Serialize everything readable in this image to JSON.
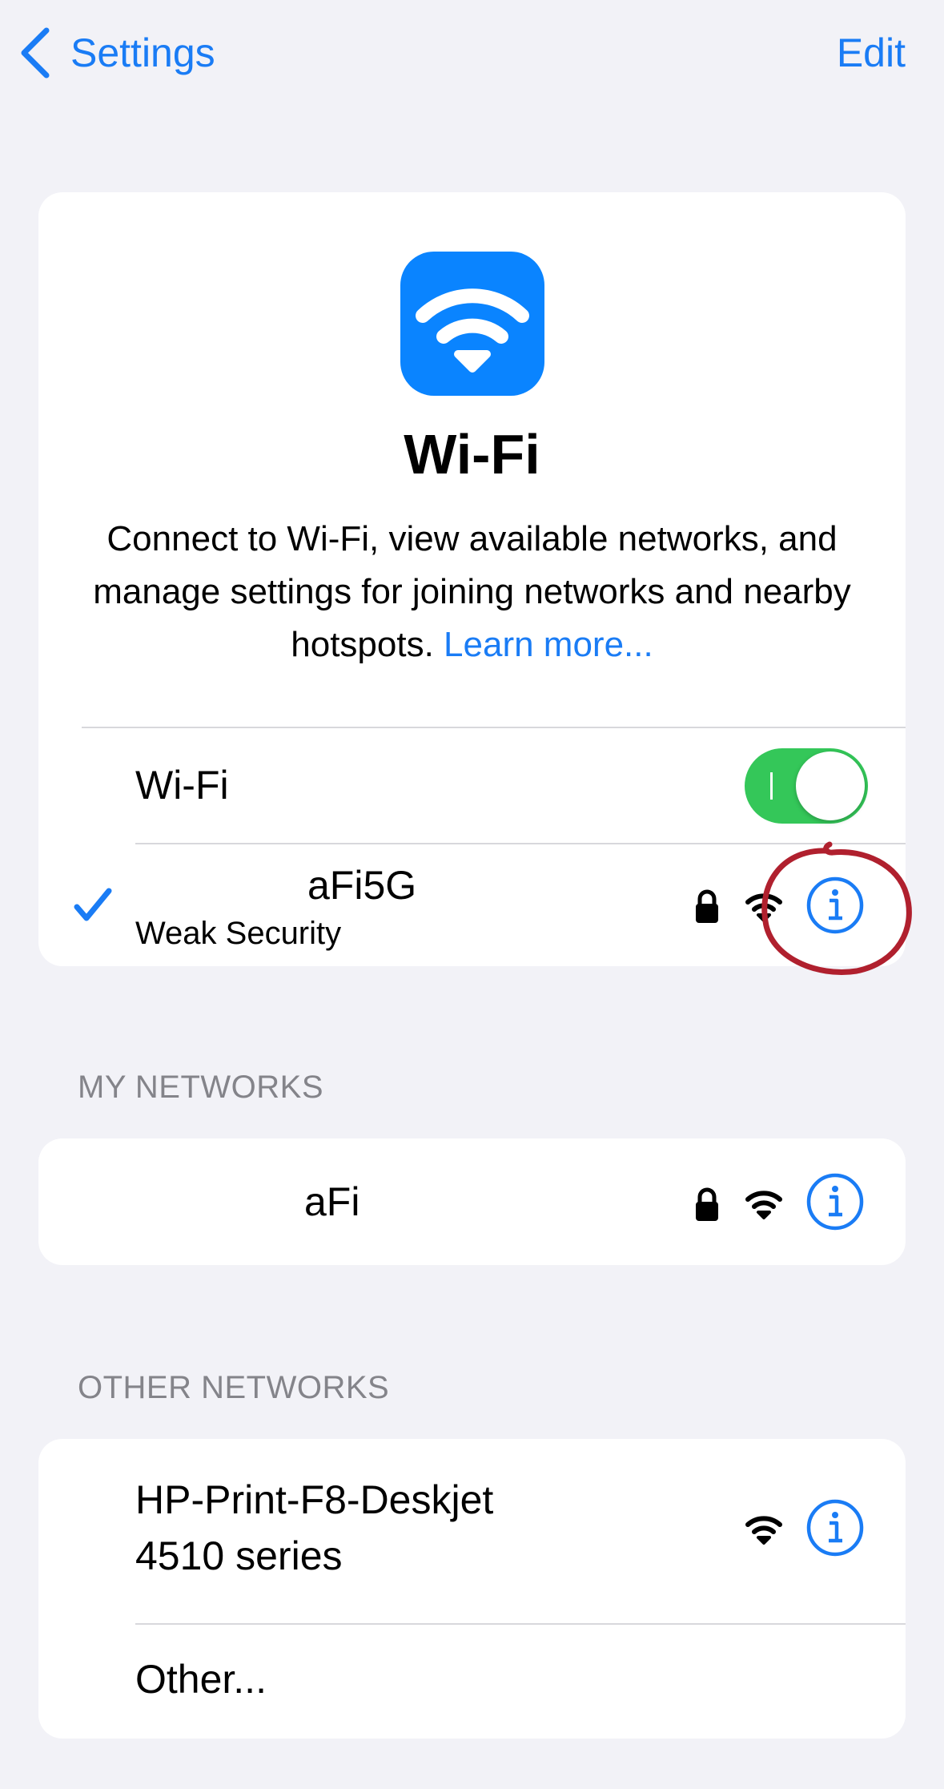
{
  "nav": {
    "back_label": "Settings",
    "edit_label": "Edit"
  },
  "hero": {
    "icon": "wifi-icon",
    "title": "Wi-Fi",
    "description": "Connect to Wi-Fi, view available networks, and manage settings for joining networks and nearby hotspots.",
    "learn_more": "Learn more..."
  },
  "wifi_toggle": {
    "label": "Wi-Fi",
    "on": true
  },
  "current_network": {
    "name": "aFi5G",
    "subtitle": "Weak Security",
    "connected": true,
    "secured": true
  },
  "my_networks": {
    "header": "MY NETWORKS",
    "items": [
      {
        "name": "aFi",
        "secured": true
      }
    ]
  },
  "other_networks": {
    "header": "OTHER NETWORKS",
    "items": [
      {
        "name_line1": "HP-Print-F8-Deskjet",
        "name_line2": "4510 series",
        "secured": false
      }
    ],
    "other_label": "Other..."
  },
  "colors": {
    "accent": "#1a7cf5",
    "toggle_on": "#34c759",
    "background": "#f2f2f7",
    "annotation": "#b0202e"
  }
}
